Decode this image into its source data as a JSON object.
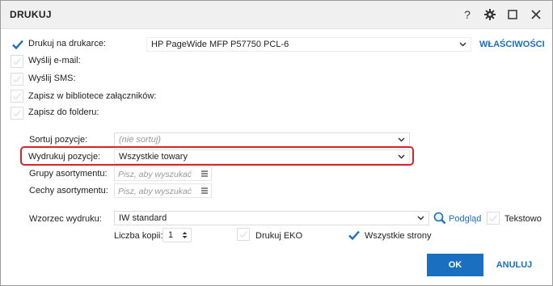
{
  "window": {
    "title": "DRUKUJ",
    "help_label": "?"
  },
  "options": {
    "print_printer": {
      "label": "Drukuj na drukarce:",
      "checked": true
    },
    "send_email": {
      "label": "Wyślij e-mail:",
      "checked": false
    },
    "send_sms": {
      "label": "Wyślij SMS:",
      "checked": false
    },
    "save_attachments": {
      "label": "Zapisz w bibliotece załączników:",
      "checked": false
    },
    "save_folder": {
      "label": "Zapisz do folderu:",
      "checked": false
    }
  },
  "printer": {
    "selected": "HP PageWide MFP P57750 PCL-6",
    "properties_link": "WŁAŚCIWOŚCI"
  },
  "sort": {
    "label": "Sortuj pozycje:",
    "value": "(nie sortuj)"
  },
  "print_items": {
    "label": "Wydrukuj pozycje:",
    "value": "Wszystkie towary"
  },
  "assortment_groups": {
    "label": "Grupy asortymentu:",
    "placeholder": "Pisz, aby wyszukać"
  },
  "assortment_features": {
    "label": "Cechy asortymentu:",
    "placeholder": "Pisz, aby wyszukać"
  },
  "template": {
    "label": "Wzorzec wydruku:",
    "value": "IW standard",
    "preview_link": "Podgląd",
    "text_label": "Tekstowo",
    "text_checked": false
  },
  "copies": {
    "label": "Liczba kopii:",
    "value": "1"
  },
  "eco": {
    "label": "Drukuj EKO",
    "checked": false
  },
  "all_pages": {
    "label": "Wszystkie strony",
    "checked": true
  },
  "buttons": {
    "ok": "OK",
    "cancel": "ANULUJ"
  },
  "colors": {
    "accent": "#1a6fc0",
    "highlight": "#d9232b"
  }
}
